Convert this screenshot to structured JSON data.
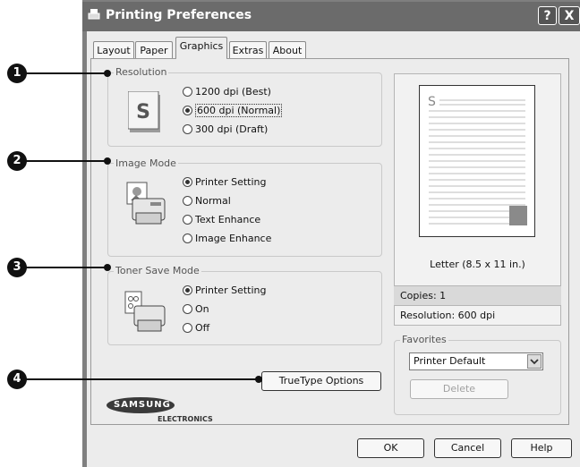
{
  "window": {
    "title": "Printing Preferences",
    "help_btn": "?",
    "close_btn": "X"
  },
  "tabs": [
    {
      "label": "Layout"
    },
    {
      "label": "Paper"
    },
    {
      "label": "Graphics"
    },
    {
      "label": "Extras"
    },
    {
      "label": "About"
    }
  ],
  "resolution": {
    "legend": "Resolution",
    "options": [
      "1200 dpi (Best)",
      "600 dpi (Normal)",
      "300 dpi (Draft)"
    ],
    "selected": "600 dpi (Normal)"
  },
  "image_mode": {
    "legend": "Image Mode",
    "options": [
      "Printer Setting",
      "Normal",
      "Text Enhance",
      "Image Enhance"
    ],
    "selected": "Printer Setting"
  },
  "toner_save": {
    "legend": "Toner Save Mode",
    "options": [
      "Printer Setting",
      "On",
      "Off"
    ],
    "selected": "Printer Setting"
  },
  "truetype_button": "TrueType Options",
  "preview": {
    "paper_label": "Letter (8.5 x 11 in.)",
    "copies": "Copies: 1",
    "resolution": "Resolution: 600 dpi",
    "letter_glyph": "S"
  },
  "favorites": {
    "legend": "Favorites",
    "selected": "Printer Default",
    "delete_label": "Delete"
  },
  "logo": {
    "brand": "SAMSUNG",
    "sub": "ELECTRONICS"
  },
  "footer": {
    "ok": "OK",
    "cancel": "Cancel",
    "help": "Help"
  },
  "callouts": [
    "1",
    "2",
    "3",
    "4"
  ],
  "icon_resolution_letter": "S"
}
